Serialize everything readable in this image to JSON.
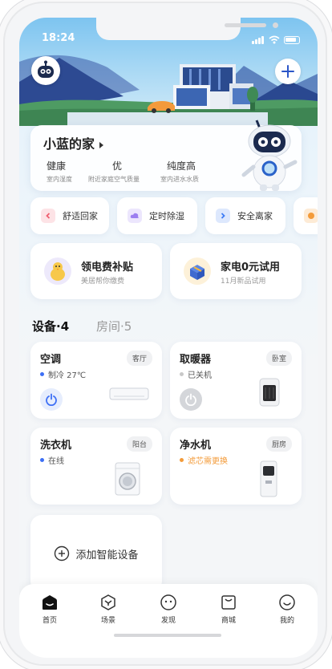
{
  "status_bar": {
    "time": "18:24"
  },
  "home": {
    "name": "小蓝的家",
    "stats": [
      {
        "value": "健康",
        "label": "室内湿度"
      },
      {
        "value": "优",
        "label": "附近家庭空气质量"
      },
      {
        "value": "纯度高",
        "label": "室内进水水质"
      }
    ]
  },
  "scenes": [
    {
      "label": "舒适回家",
      "icon": "home-scene-icon",
      "color": "#ef5e6f"
    },
    {
      "label": "定时除湿",
      "icon": "cloud-icon",
      "color": "#9c7ff0"
    },
    {
      "label": "安全离家",
      "icon": "exit-icon",
      "color": "#3d7cf5"
    },
    {
      "label": "",
      "icon": "scene-icon",
      "color": "#f39b3a"
    }
  ],
  "promos": [
    {
      "title": "领电费补贴",
      "subtitle": "美居帮你缴费",
      "icon": "chick-icon"
    },
    {
      "title": "家电0元试用",
      "subtitle": "11月新品试用",
      "icon": "gift-box-icon"
    }
  ],
  "tabs": {
    "devices": "设备·4",
    "rooms": "房间·5"
  },
  "devices": [
    {
      "name": "空调",
      "room": "客厅",
      "status": "制冷 27℃",
      "status_color": "#3d6ff5",
      "power": "on"
    },
    {
      "name": "取暖器",
      "room": "卧室",
      "status": "已关机",
      "status_color": "#c8c8c8",
      "power": "off"
    },
    {
      "name": "洗衣机",
      "room": "阳台",
      "status": "在线",
      "status_color": "#3d6ff5"
    },
    {
      "name": "净水机",
      "room": "厨房",
      "status": "滤芯需更换",
      "status_color": "#f39b3a"
    }
  ],
  "add_device": {
    "label": "添加智能设备"
  },
  "nav": [
    {
      "label": "首页",
      "icon": "home-icon",
      "active": true
    },
    {
      "label": "场景",
      "icon": "scene-cube-icon"
    },
    {
      "label": "发现",
      "icon": "discover-icon"
    },
    {
      "label": "商城",
      "icon": "shop-icon"
    },
    {
      "label": "我的",
      "icon": "profile-icon"
    }
  ],
  "colors": {
    "accent": "#3d6ff5",
    "warning": "#f39b3a",
    "brand_dark": "#1b2a4e"
  }
}
